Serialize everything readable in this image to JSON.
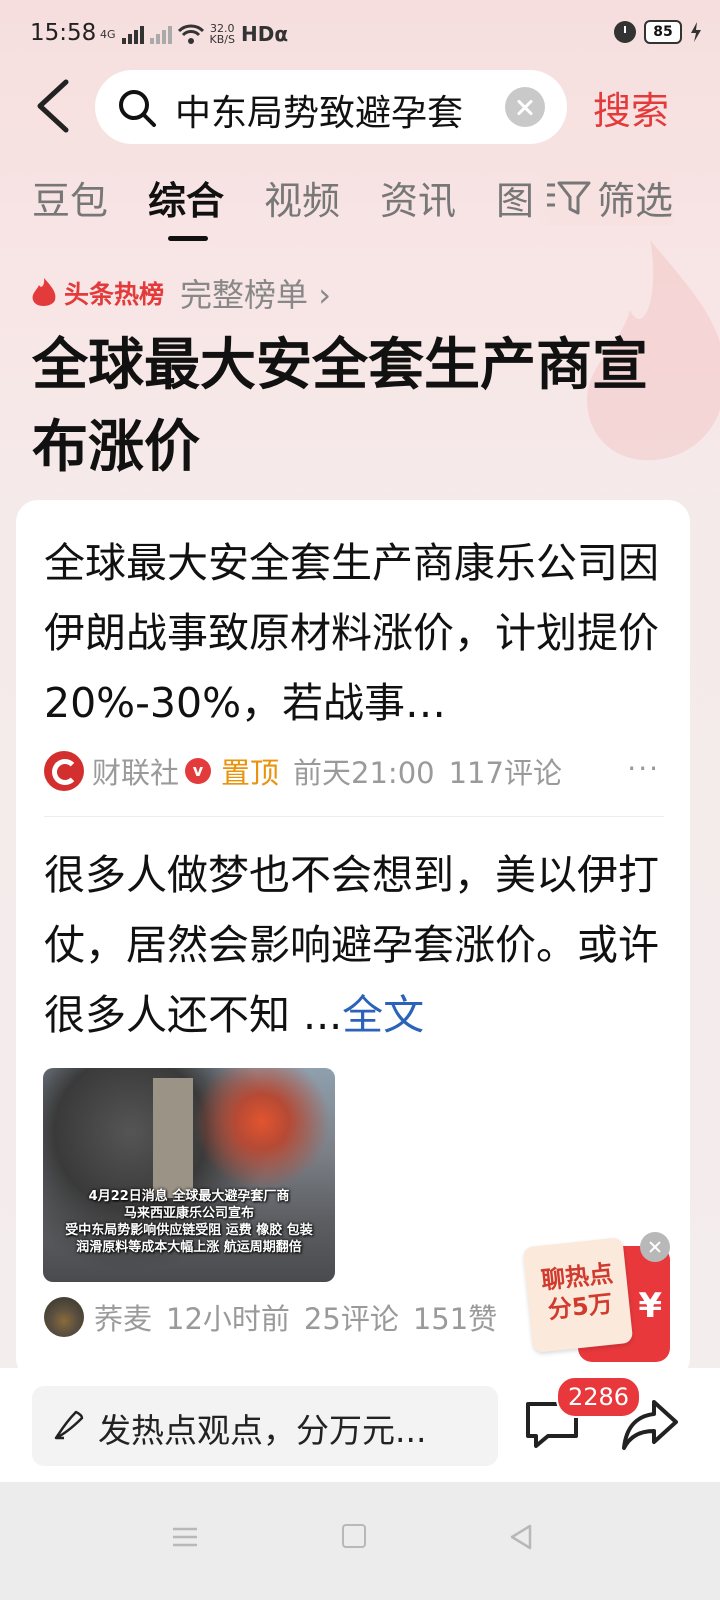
{
  "status_bar": {
    "time": "15:58",
    "network": "4G",
    "speed_value": "32.0",
    "speed_unit": "KB/S",
    "hd": "HDα",
    "battery": "85"
  },
  "search": {
    "query": "中东局势致避孕套",
    "button_label": "搜索"
  },
  "tabs": [
    {
      "label": "豆包"
    },
    {
      "label": "综合"
    },
    {
      "label": "视频"
    },
    {
      "label": "资讯"
    },
    {
      "label": "图"
    }
  ],
  "filter_label": "筛选",
  "hot": {
    "badge_label": "头条热榜",
    "full_list_label": "完整榜单 ›",
    "title": "全球最大安全套生产商宣布涨价"
  },
  "results": [
    {
      "text": "全球最大安全套生产商康乐公司因伊朗战事致原材料涨价，计划提价20%-30%，若战事…",
      "source": "财联社",
      "verified": "v",
      "pinned": "置顶",
      "time": "前天21:00",
      "comments": "117评论",
      "more": "···"
    },
    {
      "text": "很多人做梦也不会想到，美以伊打仗，居然会影响避孕套涨价。或许很多人还不知 ...",
      "full_text_label": "全文",
      "image_caption_lines": [
        "4月22日消息 全球最大避孕套厂商",
        "马来西亚康乐公司宣布",
        "受中东局势影响供应链受阻 运费 橡胶 包装",
        "润滑原料等成本大幅上涨 航运周期翻倍"
      ],
      "author": "荞麦",
      "time": "12小时前",
      "comments": "25评论",
      "likes": "151赞"
    }
  ],
  "promo": {
    "line1": "聊热点",
    "line2": "分5万",
    "symbol": "¥"
  },
  "bottom_bar": {
    "comment_placeholder": "发热点观点，分万元...",
    "comment_count": "2286"
  }
}
